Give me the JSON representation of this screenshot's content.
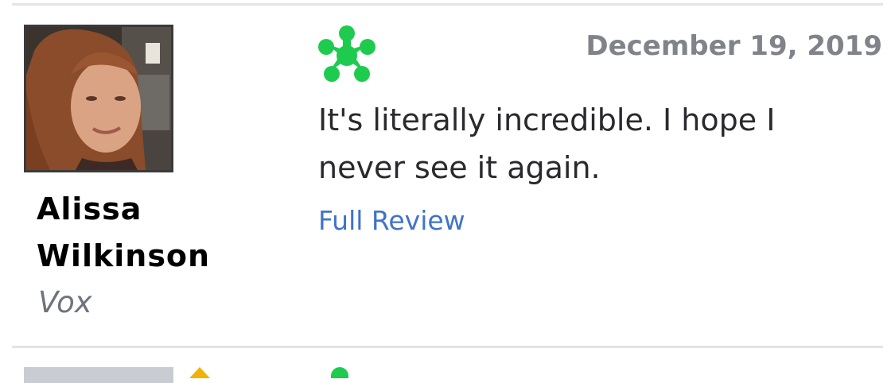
{
  "review": {
    "critic_name": "Alissa Wilkinson",
    "publication": "Vox",
    "date": "December 19, 2019",
    "quote": "It's literally incredible. I hope I never see it again.",
    "full_review_label": "Full Review",
    "score_icon": "fresh-splat-icon",
    "score_color": "#1ecb4f"
  },
  "colors": {
    "link": "#3f74c7",
    "date": "#808389",
    "publication": "#6f737c",
    "divider": "#e4e4e6",
    "rating_star": "#f2b203"
  }
}
